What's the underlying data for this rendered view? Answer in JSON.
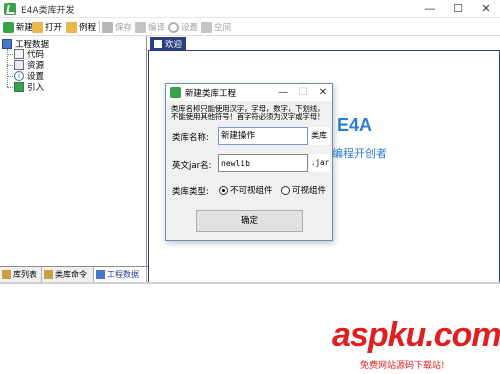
{
  "window": {
    "title": "E4A类库开发",
    "min_glyph": "—",
    "max_glyph": "☐",
    "close_glyph": "✕"
  },
  "toolbar": {
    "items": [
      {
        "label": "新建",
        "icon": "new-icon",
        "enabled": true
      },
      {
        "label": "打开",
        "icon": "open-folder-icon",
        "enabled": true
      },
      {
        "label": "例程",
        "icon": "example-folder-icon",
        "enabled": true
      },
      {
        "label": "保存",
        "icon": "save-icon",
        "enabled": false
      },
      {
        "label": "编译",
        "icon": "compile-icon",
        "enabled": false
      },
      {
        "label": "设置",
        "icon": "settings-icon",
        "enabled": false
      },
      {
        "label": "空间",
        "icon": "space-icon",
        "enabled": false
      }
    ]
  },
  "tree": {
    "root": "工程数据",
    "children": [
      {
        "label": "代码",
        "icon": "code-file-icon"
      },
      {
        "label": "资源",
        "icon": "resource-icon"
      },
      {
        "label": "设置",
        "icon": "info-settings-icon"
      },
      {
        "label": "引入",
        "icon": "import-icon"
      }
    ]
  },
  "left_tabs": [
    {
      "label": "库列表",
      "active": false
    },
    {
      "label": "类库命令",
      "active": false
    },
    {
      "label": "工程数据",
      "active": true
    }
  ],
  "editor": {
    "tab_label": "欢迎",
    "brand_text": "E4A",
    "brand_tagline": "编程开创者"
  },
  "dialog": {
    "title": "新建类库工程",
    "note_line1": "类库名称只能使用汉字，字母，数字，下划线，",
    "note_line2": "不能使用其他符号！首字符必须为汉字或字母！",
    "name_label": "类库名称:",
    "name_value": "新建操作",
    "name_suffix": "类库",
    "jar_label": "英文jar名:",
    "jar_value": "newlib",
    "jar_suffix": ".jar",
    "type_label": "类库类型:",
    "type_options": [
      {
        "label": "不可视组件",
        "checked": true
      },
      {
        "label": "可视组件",
        "checked": false
      }
    ],
    "ok_label": "确定"
  },
  "watermark": {
    "main": "aspku.com",
    "sub": "免费网站源码下载站!"
  },
  "colors": {
    "tab_active": "#2c3f7e",
    "brand_blue": "#2d7dd2",
    "watermark_red": "#e02020",
    "app_green": "#3aa14a"
  }
}
